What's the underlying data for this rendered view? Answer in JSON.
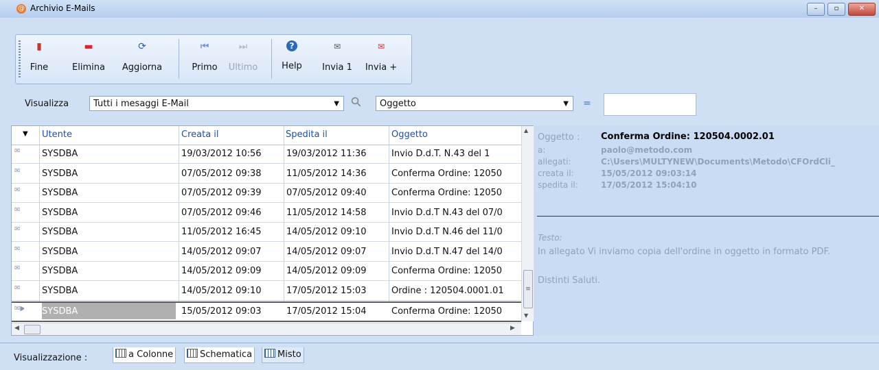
{
  "window": {
    "title": "Archivio E-Mails",
    "minimize": "–",
    "maximize": "▫",
    "close": "✕"
  },
  "toolbar": {
    "fine": "Fine",
    "elimina": "Elimina",
    "aggiorna": "Aggiorna",
    "primo": "Primo",
    "ultimo": "Ultimo",
    "help": "Help",
    "invia1": "Invia 1",
    "invia_plus": "Invia +"
  },
  "filter": {
    "label": "Visualizza",
    "view_value": "Tutti i mesaggi E-Mail",
    "field_value": "Oggetto",
    "equals": "=",
    "search_value": ""
  },
  "grid": {
    "columns": [
      "Utente",
      "Creata il",
      "Spedita il",
      "Oggetto"
    ],
    "rows": [
      [
        "SYSDBA",
        "19/03/2012 10:56",
        "19/03/2012 11:36",
        "Invio D.d.T. N.43      del 1"
      ],
      [
        "SYSDBA",
        "07/05/2012 09:38",
        "11/05/2012 14:36",
        "Conferma Ordine: 12050"
      ],
      [
        "SYSDBA",
        "07/05/2012 09:39",
        "07/05/2012 09:40",
        "Conferma Ordine: 12050"
      ],
      [
        "SYSDBA",
        "07/05/2012 09:46",
        "11/05/2012 14:58",
        "Invio D.d.T N.43 del 07/0"
      ],
      [
        "SYSDBA",
        "11/05/2012 16:45",
        "14/05/2012 09:10",
        "Invio D.d.T N.46 del 11/0"
      ],
      [
        "SYSDBA",
        "14/05/2012 09:07",
        "14/05/2012 09:07",
        "Invio D.d.T N.47 del 14/0"
      ],
      [
        "SYSDBA",
        "14/05/2012 09:09",
        "14/05/2012 09:09",
        "Conferma Ordine: 12050"
      ],
      [
        "SYSDBA",
        "14/05/2012 09:10",
        "17/05/2012 15:03",
        "Ordine : 120504.0001.01"
      ],
      [
        "SYSDBA",
        "15/05/2012 09:03",
        "17/05/2012 15:04",
        "Conferma Ordine: 12050"
      ]
    ],
    "selected_row": 8
  },
  "detail": {
    "oggetto_label": "Oggetto :",
    "oggetto": "Conferma Ordine: 120504.0002.01",
    "a_label": "a:",
    "a": "paolo@metodo.com",
    "allegati_label": "allegati:",
    "allegati": "C:\\Users\\MULTYNEW\\Documents\\Metodo\\CFOrdCli_",
    "creata_label": "creata il:",
    "creata": "15/05/2012 09:03:14",
    "spedita_label": "spedita il:",
    "spedita": "17/05/2012 15:04:10",
    "testo_label": "Testo:",
    "testo_line1": "In allegato Vi inviamo copia dell'ordine in oggetto in formato PDF.",
    "testo_line2": "Distinti Saluti."
  },
  "bottom": {
    "label": "Visualizzazione :",
    "tabs": [
      "a Colonne",
      "Schematica",
      "Misto"
    ]
  }
}
